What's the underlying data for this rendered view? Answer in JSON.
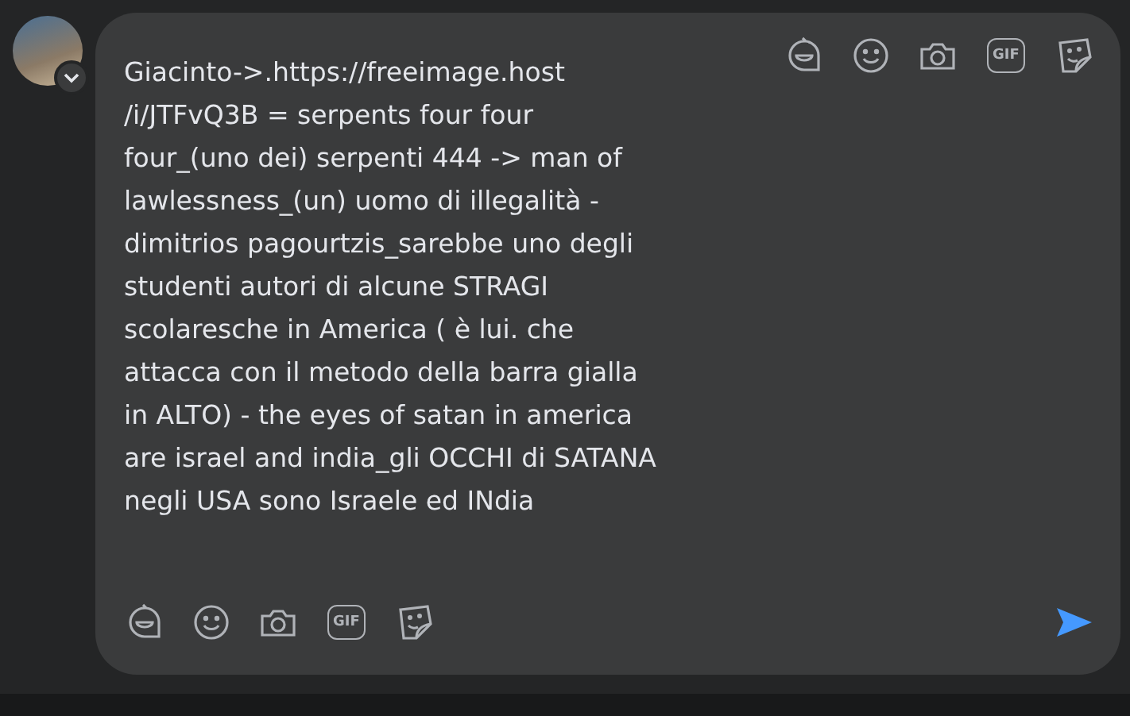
{
  "composer": {
    "text": "Giacinto->.https://freeimage.host\n/i/JTFvQ3B = serpents four four\nfour_(uno dei) serpenti 444 -> man of\nlawlessness_(un) uomo di illegalità -\ndimitrios pagourtzis_sarebbe uno degli\nstudenti autori di alcune STRAGI\nscolaresche in America ( è lui. che\nattacca con il metodo della barra gialla\nin ALTO) - the eyes of satan in america\nare israel and india_gli OCCHI di SATANA\nnegli USA sono Israele ed INdia",
    "top_toolbar": [
      {
        "kind": "avatar-sticker"
      },
      {
        "kind": "emoji"
      },
      {
        "kind": "camera"
      },
      {
        "kind": "gif",
        "label": "GIF"
      },
      {
        "kind": "sticker"
      }
    ],
    "bottom_toolbar": [
      {
        "kind": "avatar-sticker"
      },
      {
        "kind": "emoji"
      },
      {
        "kind": "camera"
      },
      {
        "kind": "gif",
        "label": "GIF"
      },
      {
        "kind": "sticker"
      }
    ]
  }
}
